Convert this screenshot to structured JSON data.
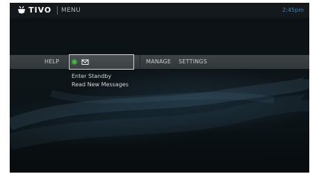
{
  "header": {
    "brand": "TIVO",
    "title": "MENU",
    "time": "2:45pm"
  },
  "menu": {
    "items": [
      {
        "label": "HELP"
      },
      {
        "label": "",
        "icons": [
          "green-status-dot",
          "envelope-icon"
        ],
        "selected": true
      },
      {
        "label": "MANAGE"
      },
      {
        "label": "SETTINGS"
      }
    ]
  },
  "submenu": {
    "items": [
      {
        "label": "Enter Standby"
      },
      {
        "label": "Read New Messages"
      }
    ]
  },
  "colors": {
    "background": "#0d1519",
    "menu_bar": "#3a3f42",
    "clock": "#3a86c8",
    "status_dot": "#3dbb3d"
  }
}
